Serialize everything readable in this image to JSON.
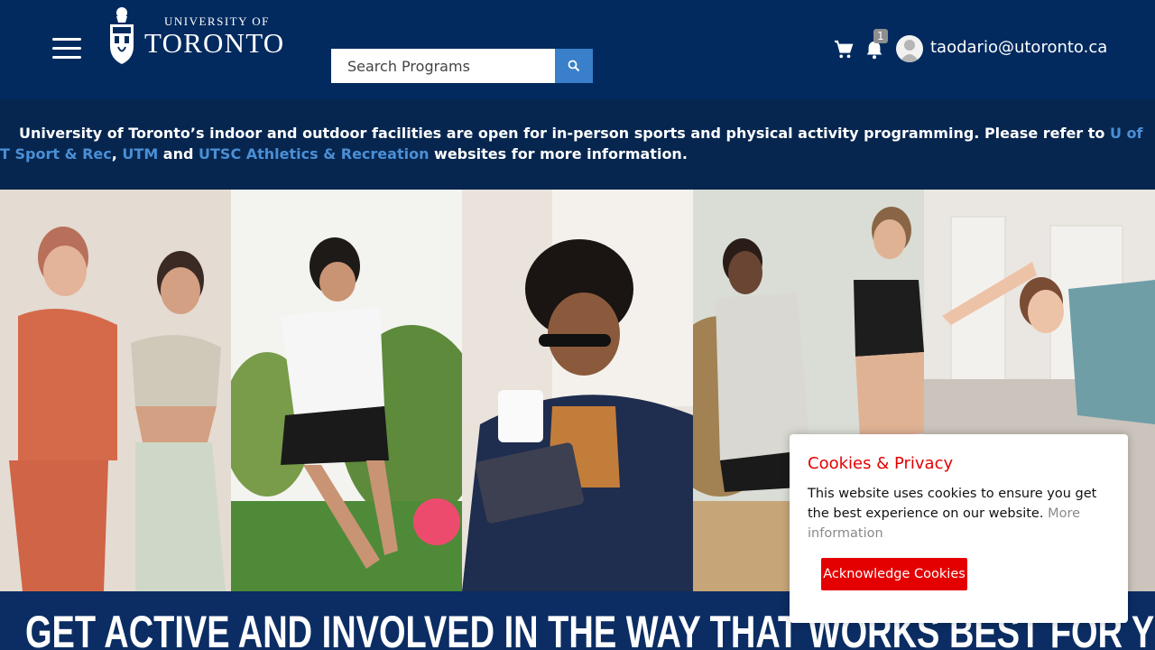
{
  "header": {
    "logo": {
      "line1": "UNIVERSITY OF",
      "line2": "TORONTO"
    },
    "search": {
      "placeholder": "Search Programs"
    },
    "notifications": {
      "count": "1"
    },
    "user": {
      "email": "taodario@utoronto.ca"
    }
  },
  "notice": {
    "text_before": "University of Toronto’s indoor and outdoor facilities are open for in-person sports and physical activity programming. Please refer to ",
    "link1": "U of T Sport & Rec",
    "sep1": ", ",
    "link2": "UTM",
    "sep2": " and ",
    "link3": "UTSC Athletics & Recreation",
    "text_after": " websites for more information."
  },
  "hero": {
    "tagline": "GET ACTIVE AND INVOLVED IN THE WAY THAT WORKS BEST FOR YOU!"
  },
  "cookie": {
    "title": "Cookies & Privacy",
    "body": "This website uses cookies to ensure you get the best experience on our website. ",
    "more_link": "More information",
    "button": "Acknowledge Cookies"
  },
  "colors": {
    "header_bg": "#022a5e",
    "notice_bg": "#06264f",
    "link": "#4a8fd6",
    "accent_red": "#e40000",
    "search_btn": "#3a7fc9"
  }
}
